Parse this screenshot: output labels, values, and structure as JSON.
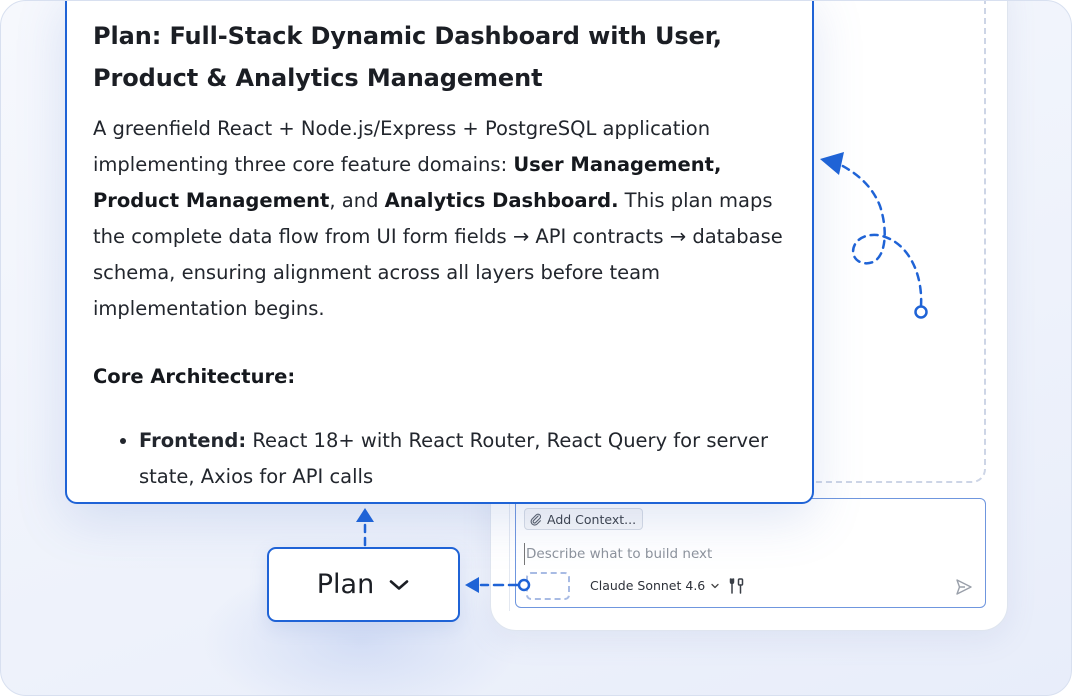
{
  "plan_card": {
    "title": "Plan: Full-Stack Dynamic Dashboard with User,\nProduct & Analytics Management",
    "intro": {
      "t1": "A greenfield React + Node.js/Express + PostgreSQL application implementing three core feature domains: ",
      "b1": "User Management, Product Management",
      "t2": ", and ",
      "b2": "Analytics Dashboard.",
      "t3": " This plan maps the complete data flow from UI form fields → API contracts → database schema, ensuring alignment across all layers before team implementation begins."
    },
    "section_heading": "Core Architecture:",
    "list_items": [
      {
        "label": "Frontend:",
        "text": " React 18+ with React Router, React Query for server state, Axios for API calls"
      }
    ]
  },
  "mode_selector": {
    "label": "Plan"
  },
  "chat_input": {
    "add_context_label": "Add Context...",
    "placeholder": "Describe what to build next",
    "model_label": "Claude Sonnet 4.6"
  },
  "icons": {
    "attach": "paperclip-icon",
    "chevron": "chevron-down-icon",
    "tools": "tools-icon",
    "send": "send-icon"
  },
  "colors": {
    "accent": "#1f63d6",
    "input_border": "#6f96de",
    "dashed": "#cdd5e6"
  }
}
